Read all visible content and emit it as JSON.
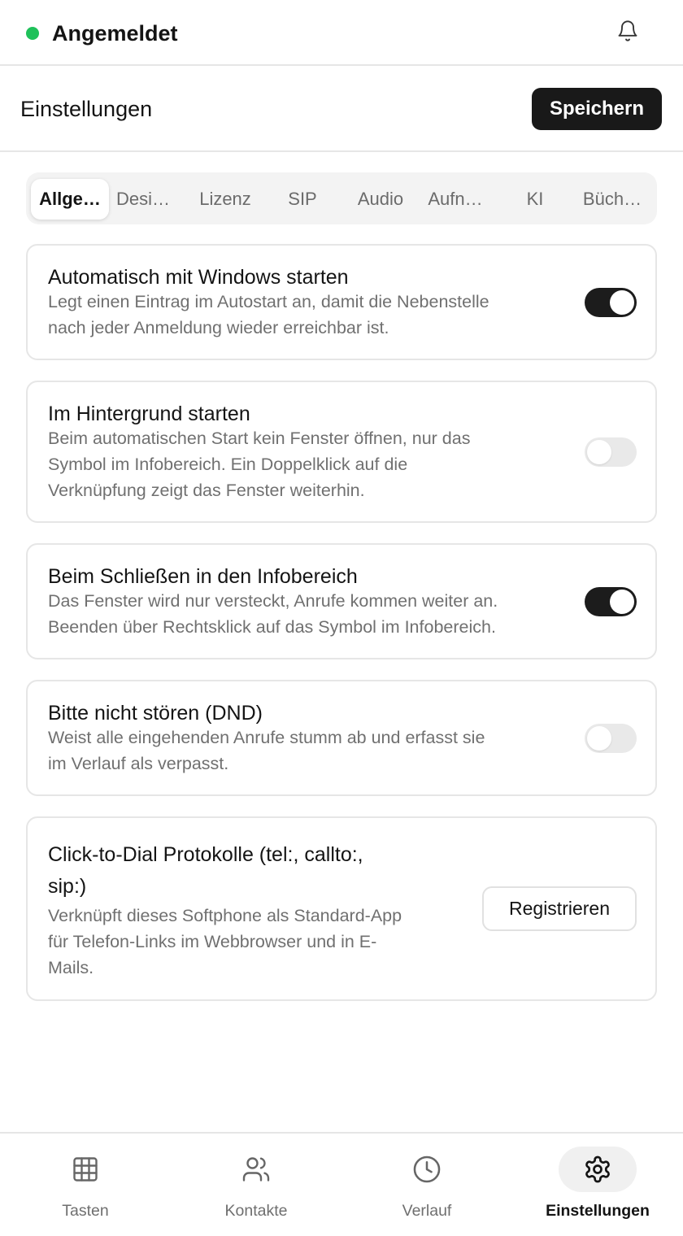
{
  "status": {
    "text": "Angemeldet",
    "color": "#1fc15a",
    "icon": "bell-icon"
  },
  "header": {
    "title": "Einstellungen",
    "save_label": "Speichern"
  },
  "tabs": [
    {
      "label": "Allge…",
      "active": true
    },
    {
      "label": "Desi…",
      "active": false
    },
    {
      "label": "Lizenz",
      "active": false
    },
    {
      "label": "SIP",
      "active": false
    },
    {
      "label": "Audio",
      "active": false
    },
    {
      "label": "Aufn…",
      "active": false
    },
    {
      "label": "KI",
      "active": false
    },
    {
      "label": "Büch…",
      "active": false
    }
  ],
  "settings": [
    {
      "title": "Automatisch mit Windows starten",
      "desc": [
        "Legt einen Eintrag im Autostart an, damit die Nebenstelle",
        "nach jeder Anmeldung wieder erreichbar ist."
      ],
      "enabled": true
    },
    {
      "title": "Im Hintergrund starten",
      "desc": [
        "Beim automatischen Start kein Fenster öffnen, nur das",
        "Symbol im Infobereich. Ein Doppelklick auf die",
        "Verknüpfung zeigt das Fenster weiterhin."
      ],
      "enabled": false
    },
    {
      "title": "Beim Schließen in den Infobereich",
      "desc": [
        "Das Fenster wird nur versteckt, Anrufe kommen weiter an.",
        "Beenden über Rechtsklick auf das Symbol im Infobereich."
      ],
      "enabled": true
    },
    {
      "title": "Bitte nicht stören (DND)",
      "desc": [
        "Weist alle eingehenden Anrufe stumm ab und erfasst sie",
        "im Verlauf als verpasst."
      ],
      "enabled": false
    }
  ],
  "protocol": {
    "title": [
      "Click-to-Dial Protokolle (tel:, callto:,",
      "sip:)"
    ],
    "desc": [
      "Verknüpft dieses Softphone als Standard-App",
      "für Telefon-Links im Webbrowser und in E-",
      "Mails."
    ],
    "button": "Registrieren"
  },
  "nav": [
    {
      "label": "Tasten",
      "icon": "grid-icon",
      "active": false
    },
    {
      "label": "Kontakte",
      "icon": "users-icon",
      "active": false
    },
    {
      "label": "Verlauf",
      "icon": "clock-icon",
      "active": false
    },
    {
      "label": "Einstellungen",
      "icon": "gear-icon",
      "active": true
    }
  ]
}
